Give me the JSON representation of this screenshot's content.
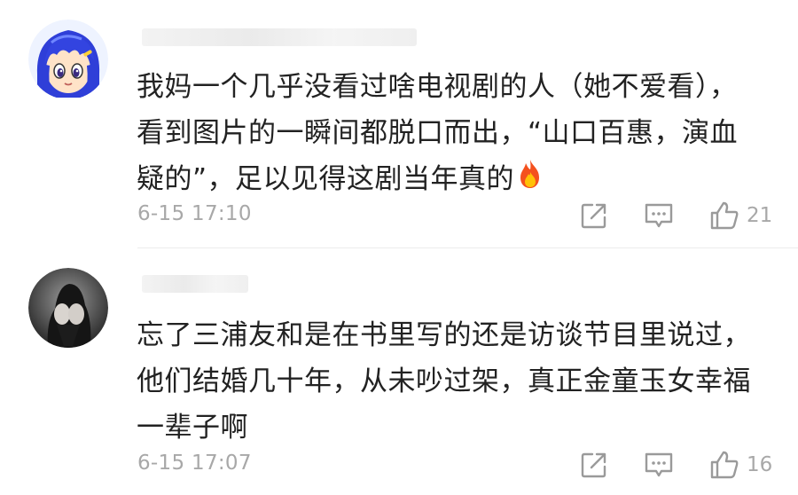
{
  "comments": [
    {
      "lines": [
        "我妈一个几乎没看过啥电视剧的人（她不爱看），",
        "看到图片的一瞬间都脱口而出，“山口百惠，演血",
        "疑的”，足以见得这剧当年真的"
      ],
      "emoji": "fire-icon",
      "time": "6-15 17:10",
      "likes": "21"
    },
    {
      "lines": [
        "忘了三浦友和是在书里写的还是访谈节目里说过，",
        "他们结婚几十年，从未吵过架，真正金童玉女幸福",
        "一辈子啊"
      ],
      "time": "6-15 17:07",
      "likes": "16"
    }
  ],
  "colors": {
    "text": "#222222",
    "meta": "#a8a8a8",
    "divider": "#ececec"
  }
}
